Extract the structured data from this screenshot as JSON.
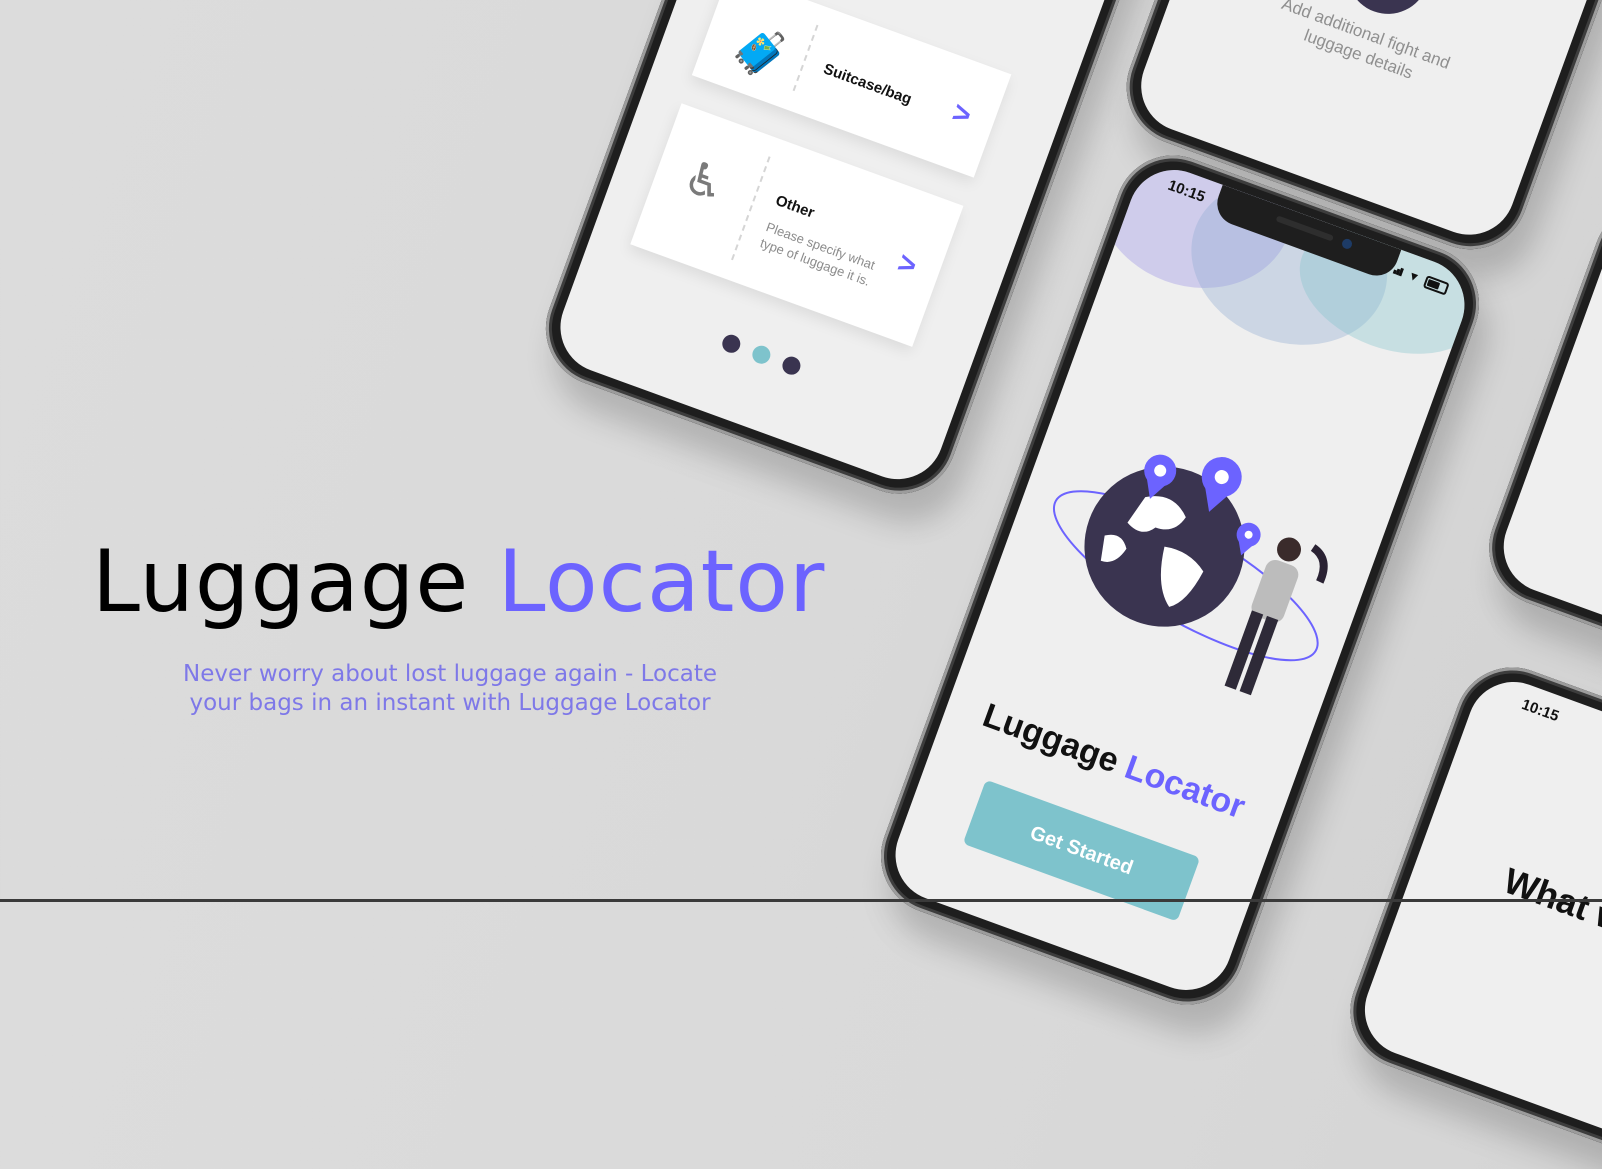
{
  "hero": {
    "title_part1": "Luggage",
    "title_part2": "Locator",
    "tagline_line1": "Never worry about lost luggage again - Locate",
    "tagline_line2": "your bags in an instant with Luggage Locator"
  },
  "colors": {
    "accent": "#6c63ff",
    "teal": "#7ec3cc",
    "dark": "#3a3450",
    "background": "#d9d9d9"
  },
  "phone_options": {
    "cards": [
      {
        "icon": "suitcase-icon",
        "title": "Suitcase/bag",
        "description": ""
      },
      {
        "icon": "wheelchair-icon",
        "title": "Other",
        "description": "Please specify what type of luggage it is."
      }
    ],
    "pager": {
      "count": 3,
      "active_index": 1
    }
  },
  "phone_add": {
    "add_label": "Add additional fight and luggage details"
  },
  "phone_onboarding": {
    "status_time": "10:15",
    "title_part1": "Luggage",
    "title_part2": "Locator",
    "cta_label": "Get Started"
  },
  "phone_bottom": {
    "status_time": "10:15",
    "heading": "What w"
  }
}
